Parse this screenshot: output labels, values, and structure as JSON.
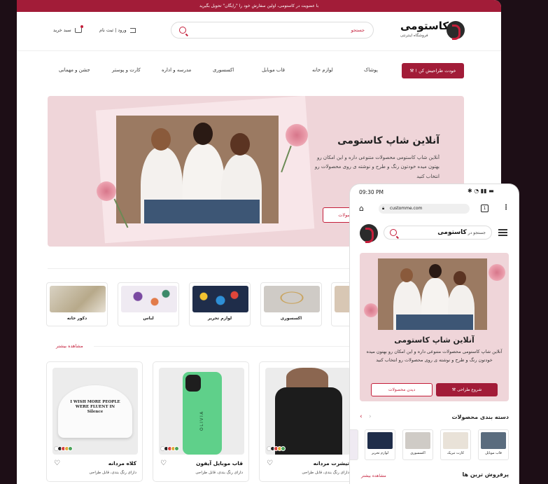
{
  "topbar": {
    "text": "با عضویت در کاستومی، اولین سفارش خود را \"رایگان\" تحویل بگیرید"
  },
  "header": {
    "logo_text": "کاستومی",
    "logo_sub": "فروشگاه اینترنتی",
    "search_placeholder": "جستجو",
    "login_label": "ورود | ثبت نام",
    "cart_label": "سبد خرید"
  },
  "nav": {
    "design_button": "خودت طراحیش کن !",
    "items": [
      "پوشاک",
      "لوازم خانه",
      "قاب موبایل",
      "اکسسوری",
      "مدرسه و اداره",
      "کارت و پوستر",
      "جشن و مهمانی"
    ]
  },
  "hero": {
    "title": "آنلاین شاپ کاستومی",
    "desc": "آنلاین شاپ کاستومی محصولات متنوعی  داره و این امکان رو بهتون میده خودتون رنگ و طرح و نوشته ی روی محصولات رو انتخاب کنید",
    "view_products": "دیدن محصولات"
  },
  "categories": [
    {
      "label": "دکور خانه"
    },
    {
      "label": "لباس"
    },
    {
      "label": "لوازم تحریر"
    },
    {
      "label": "اکسسوری"
    }
  ],
  "see_more": "مشاهده بیشتر",
  "products": [
    {
      "title": "کلاه مردانه",
      "sub": "دارای رنگ بندی، قابل طراحی",
      "print": "I WISH MORE PEOPLE WERE FLUENT IN Silence"
    },
    {
      "title": "قاب موبایل آیفون",
      "sub": "دارای رنگ بندی، قابل طراحی",
      "print": "OLIVIA"
    },
    {
      "title": "تیشرت مردانه",
      "sub": "دارای رنگ بندی، قابل طراحی"
    }
  ],
  "phone": {
    "time": "09:30 PM",
    "url": "customme.com",
    "tab_count": "1",
    "search_placeholder": "جستجو در",
    "search_brand": "کاستومی",
    "hero_title": "آنلاین شاپ کاستومی",
    "hero_desc": "آنلاین شاپ کاستومی محصولات متنوعی  داره و این امکان رو بهتون میده خودتون رنگ و طرح و نوشته ی روی محصولات رو انتخاب کنید",
    "start_design": "شروع طراحی",
    "view_products": "دیدن محصولات",
    "categories_title": "دسته بندی محصولات",
    "categories": [
      "قاب موبایل",
      "کارت تبریک",
      "اکسسوری",
      "لوازم تحریر"
    ],
    "bestsellers_title": "پرفروش ترین ها",
    "see_more": "مشاهده بیشتر"
  },
  "colors": {
    "brand": "#a21c38",
    "hero_bg": "#efd5d9",
    "page_bg": "#1d0e16"
  }
}
